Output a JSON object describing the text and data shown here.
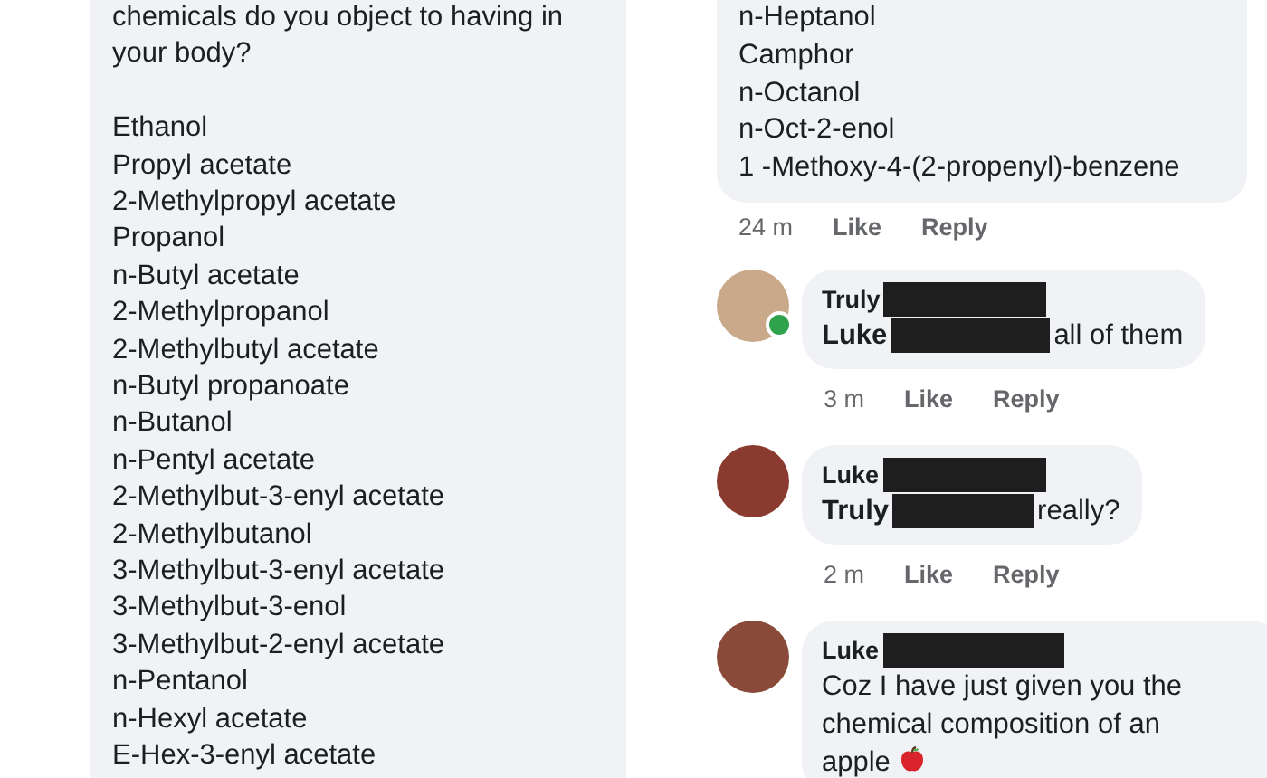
{
  "post": {
    "question_lines": [
      "chemicals do you object to having in",
      "your body?"
    ],
    "items": [
      "Ethanol",
      "Propyl acetate",
      "2-Methylpropyl acetate",
      "Propanol",
      "n-Butyl acetate",
      "2-Methylpropanol",
      "2-Methylbutyl acetate",
      "n-Butyl propanoate",
      "n-Butanol",
      "n-Pentyl acetate",
      "2-Methylbut-3-enyl acetate",
      "2-Methylbutanol",
      "3-Methylbut-3-enyl acetate",
      "3-Methylbut-3-enol",
      "3-Methylbut-2-enyl acetate",
      "n-Pentanol",
      "n-Hexyl acetate",
      "E-Hex-3-enyl acetate"
    ]
  },
  "continued": {
    "items": [
      "n-Heptanol",
      "Camphor",
      "n-Octanol",
      "n-Oct-2-enol",
      "1 -Methoxy-4-(2-propenyl)-benzene"
    ],
    "time": "24 m",
    "actions": [
      "Like",
      "Reply"
    ]
  },
  "replies": [
    {
      "author": "Truly",
      "online": true,
      "mention": "Luke",
      "text": "all of them",
      "emoji": false,
      "time": "3 m",
      "actions": [
        "Like",
        "Reply"
      ]
    },
    {
      "author": "Luke",
      "online": false,
      "mention": "Truly",
      "text": "really?",
      "emoji": false,
      "time": "2 m",
      "actions": [
        "Like",
        "Reply"
      ]
    },
    {
      "author": "Luke",
      "online": false,
      "text": "Coz I have just given you the chemical composition of an apple",
      "emoji": true
    }
  ]
}
